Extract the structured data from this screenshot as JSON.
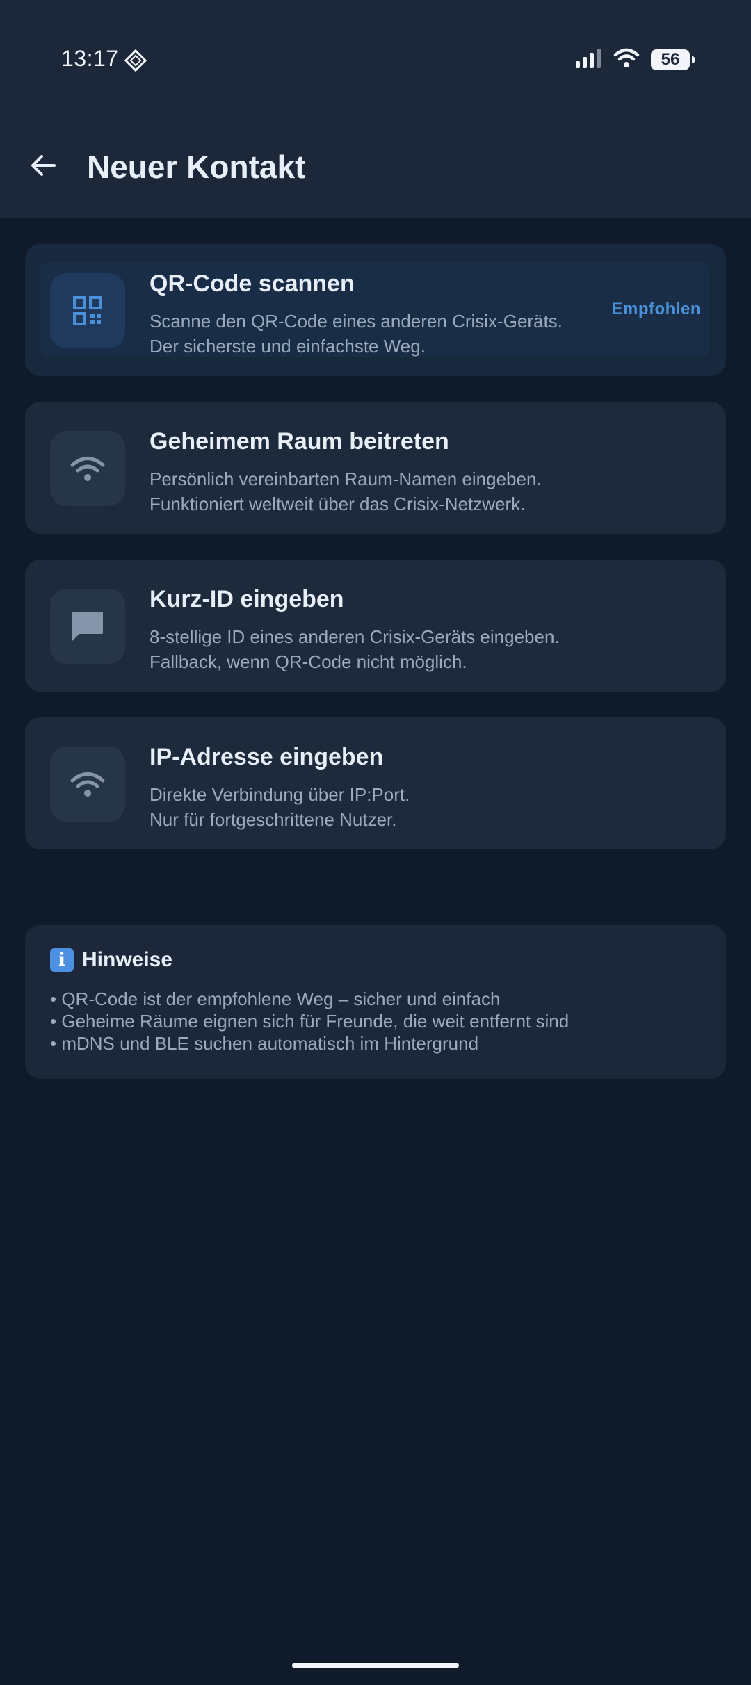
{
  "status_bar": {
    "time": "13:17",
    "battery": "56"
  },
  "app_bar": {
    "title": "Neuer Kontakt"
  },
  "options": [
    {
      "title": "QR-Code scannen",
      "line1": "Scanne den QR-Code eines anderen Crisix-Geräts.",
      "line2": "Der sicherste und einfachste Weg.",
      "badge": "Empfohlen",
      "icon": "qr-code-icon"
    },
    {
      "title": "Geheimem Raum beitreten",
      "line1": "Persönlich vereinbarten Raum-Namen eingeben.",
      "line2": "Funktioniert weltweit über das Crisix-Netzwerk.",
      "icon": "wifi-icon"
    },
    {
      "title": "Kurz-ID eingeben",
      "line1": "8-stellige ID eines anderen Crisix-Geräts eingeben.",
      "line2": "Fallback, wenn QR-Code nicht möglich.",
      "icon": "chat-icon"
    },
    {
      "title": "IP-Adresse eingeben",
      "line1": "Direkte Verbindung über IP:Port.",
      "line2": "Nur für fortgeschrittene Nutzer.",
      "icon": "wifi-icon"
    }
  ],
  "hints": {
    "icon": "i",
    "title": "Hinweise",
    "items": [
      "• QR-Code ist der empfohlene Weg – sicher und einfach",
      "• Geheime Räume eignen sich für Freunde, die weit entfernt sind",
      "• mDNS und BLE suchen automatisch im Hintergrund"
    ]
  },
  "colors": {
    "background": "#0f1a2a",
    "card": "#1d2a3c",
    "accent": "#4a90d9",
    "text_primary": "#e8eef7",
    "text_secondary": "#9aa9bc"
  }
}
